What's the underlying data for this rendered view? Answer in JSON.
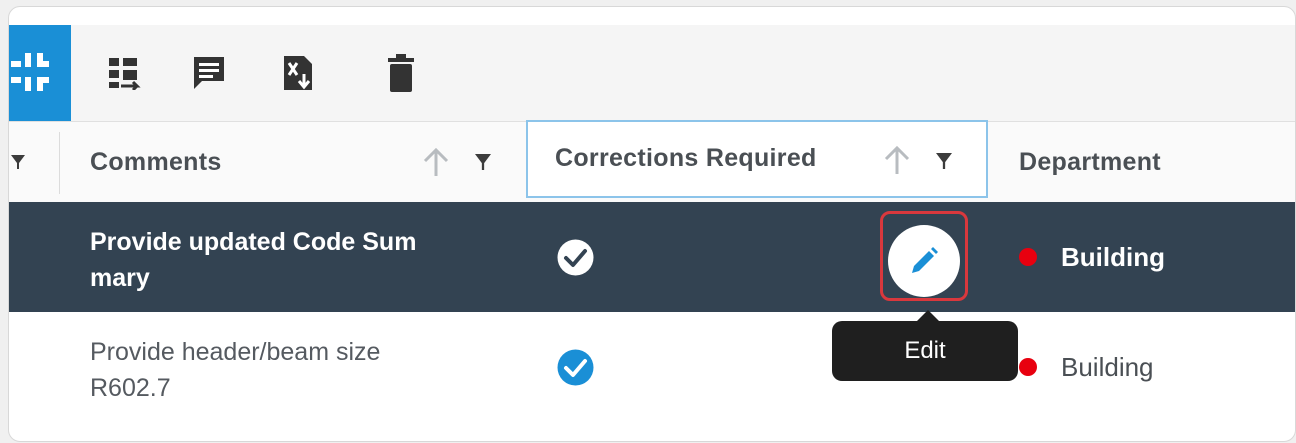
{
  "toolbar": {
    "buttons": [
      {
        "icon": "collapse-icon"
      },
      {
        "icon": "workflow-icon"
      },
      {
        "icon": "comment-icon"
      },
      {
        "icon": "excel-export-icon"
      },
      {
        "icon": "delete-icon"
      }
    ],
    "accent_color": "#1a8fd6"
  },
  "columns": {
    "comments": "Comments",
    "corrections_required": "Corrections Required",
    "department": "Department"
  },
  "rows": [
    {
      "comment": "Provide updated Code Sum mary",
      "comment_line1": "Provide updated Code Sum",
      "comment_line2": "mary",
      "corrections_required": true,
      "department": "Building",
      "status_color": "#e8000f",
      "selected": true
    },
    {
      "comment": "Provide header/beam size R602.7",
      "comment_line1": "Provide header/beam size",
      "comment_line2": "R602.7",
      "corrections_required": true,
      "department": "Building",
      "status_color": "#e8000f",
      "selected": false
    }
  ],
  "edit_button": {
    "tooltip": "Edit",
    "icon": "pencil-icon"
  },
  "colors": {
    "selected_row": "#334352",
    "highlight": "#d9383d",
    "check_blue": "#1a8fd6"
  }
}
